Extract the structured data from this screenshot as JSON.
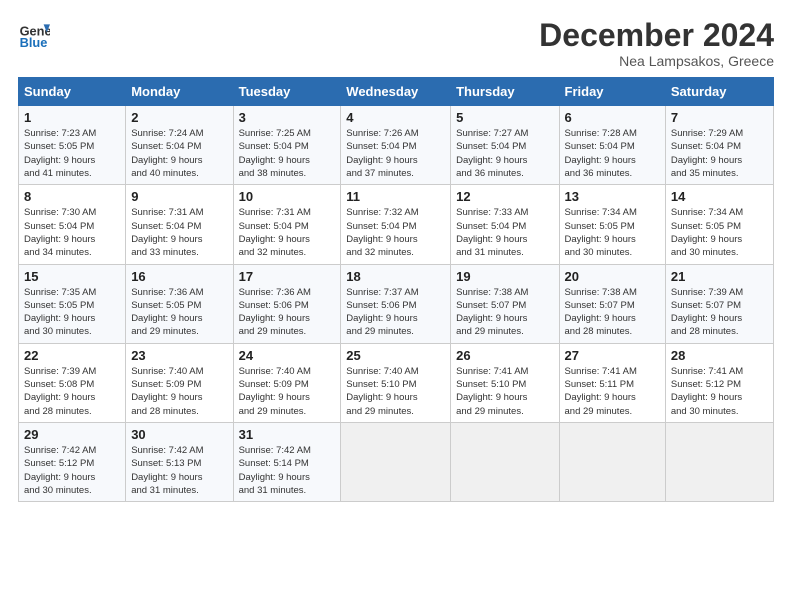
{
  "logo": {
    "line1": "General",
    "line2": "Blue"
  },
  "title": "December 2024",
  "subtitle": "Nea Lampsakos, Greece",
  "weekdays": [
    "Sunday",
    "Monday",
    "Tuesday",
    "Wednesday",
    "Thursday",
    "Friday",
    "Saturday"
  ],
  "weeks": [
    [
      {
        "day": "1",
        "info": "Sunrise: 7:23 AM\nSunset: 5:05 PM\nDaylight: 9 hours\nand 41 minutes."
      },
      {
        "day": "2",
        "info": "Sunrise: 7:24 AM\nSunset: 5:04 PM\nDaylight: 9 hours\nand 40 minutes."
      },
      {
        "day": "3",
        "info": "Sunrise: 7:25 AM\nSunset: 5:04 PM\nDaylight: 9 hours\nand 38 minutes."
      },
      {
        "day": "4",
        "info": "Sunrise: 7:26 AM\nSunset: 5:04 PM\nDaylight: 9 hours\nand 37 minutes."
      },
      {
        "day": "5",
        "info": "Sunrise: 7:27 AM\nSunset: 5:04 PM\nDaylight: 9 hours\nand 36 minutes."
      },
      {
        "day": "6",
        "info": "Sunrise: 7:28 AM\nSunset: 5:04 PM\nDaylight: 9 hours\nand 36 minutes."
      },
      {
        "day": "7",
        "info": "Sunrise: 7:29 AM\nSunset: 5:04 PM\nDaylight: 9 hours\nand 35 minutes."
      }
    ],
    [
      {
        "day": "8",
        "info": "Sunrise: 7:30 AM\nSunset: 5:04 PM\nDaylight: 9 hours\nand 34 minutes."
      },
      {
        "day": "9",
        "info": "Sunrise: 7:31 AM\nSunset: 5:04 PM\nDaylight: 9 hours\nand 33 minutes."
      },
      {
        "day": "10",
        "info": "Sunrise: 7:31 AM\nSunset: 5:04 PM\nDaylight: 9 hours\nand 32 minutes."
      },
      {
        "day": "11",
        "info": "Sunrise: 7:32 AM\nSunset: 5:04 PM\nDaylight: 9 hours\nand 32 minutes."
      },
      {
        "day": "12",
        "info": "Sunrise: 7:33 AM\nSunset: 5:04 PM\nDaylight: 9 hours\nand 31 minutes."
      },
      {
        "day": "13",
        "info": "Sunrise: 7:34 AM\nSunset: 5:05 PM\nDaylight: 9 hours\nand 30 minutes."
      },
      {
        "day": "14",
        "info": "Sunrise: 7:34 AM\nSunset: 5:05 PM\nDaylight: 9 hours\nand 30 minutes."
      }
    ],
    [
      {
        "day": "15",
        "info": "Sunrise: 7:35 AM\nSunset: 5:05 PM\nDaylight: 9 hours\nand 30 minutes."
      },
      {
        "day": "16",
        "info": "Sunrise: 7:36 AM\nSunset: 5:05 PM\nDaylight: 9 hours\nand 29 minutes."
      },
      {
        "day": "17",
        "info": "Sunrise: 7:36 AM\nSunset: 5:06 PM\nDaylight: 9 hours\nand 29 minutes."
      },
      {
        "day": "18",
        "info": "Sunrise: 7:37 AM\nSunset: 5:06 PM\nDaylight: 9 hours\nand 29 minutes."
      },
      {
        "day": "19",
        "info": "Sunrise: 7:38 AM\nSunset: 5:07 PM\nDaylight: 9 hours\nand 29 minutes."
      },
      {
        "day": "20",
        "info": "Sunrise: 7:38 AM\nSunset: 5:07 PM\nDaylight: 9 hours\nand 28 minutes."
      },
      {
        "day": "21",
        "info": "Sunrise: 7:39 AM\nSunset: 5:07 PM\nDaylight: 9 hours\nand 28 minutes."
      }
    ],
    [
      {
        "day": "22",
        "info": "Sunrise: 7:39 AM\nSunset: 5:08 PM\nDaylight: 9 hours\nand 28 minutes."
      },
      {
        "day": "23",
        "info": "Sunrise: 7:40 AM\nSunset: 5:09 PM\nDaylight: 9 hours\nand 28 minutes."
      },
      {
        "day": "24",
        "info": "Sunrise: 7:40 AM\nSunset: 5:09 PM\nDaylight: 9 hours\nand 29 minutes."
      },
      {
        "day": "25",
        "info": "Sunrise: 7:40 AM\nSunset: 5:10 PM\nDaylight: 9 hours\nand 29 minutes."
      },
      {
        "day": "26",
        "info": "Sunrise: 7:41 AM\nSunset: 5:10 PM\nDaylight: 9 hours\nand 29 minutes."
      },
      {
        "day": "27",
        "info": "Sunrise: 7:41 AM\nSunset: 5:11 PM\nDaylight: 9 hours\nand 29 minutes."
      },
      {
        "day": "28",
        "info": "Sunrise: 7:41 AM\nSunset: 5:12 PM\nDaylight: 9 hours\nand 30 minutes."
      }
    ],
    [
      {
        "day": "29",
        "info": "Sunrise: 7:42 AM\nSunset: 5:12 PM\nDaylight: 9 hours\nand 30 minutes."
      },
      {
        "day": "30",
        "info": "Sunrise: 7:42 AM\nSunset: 5:13 PM\nDaylight: 9 hours\nand 31 minutes."
      },
      {
        "day": "31",
        "info": "Sunrise: 7:42 AM\nSunset: 5:14 PM\nDaylight: 9 hours\nand 31 minutes."
      },
      null,
      null,
      null,
      null
    ]
  ]
}
